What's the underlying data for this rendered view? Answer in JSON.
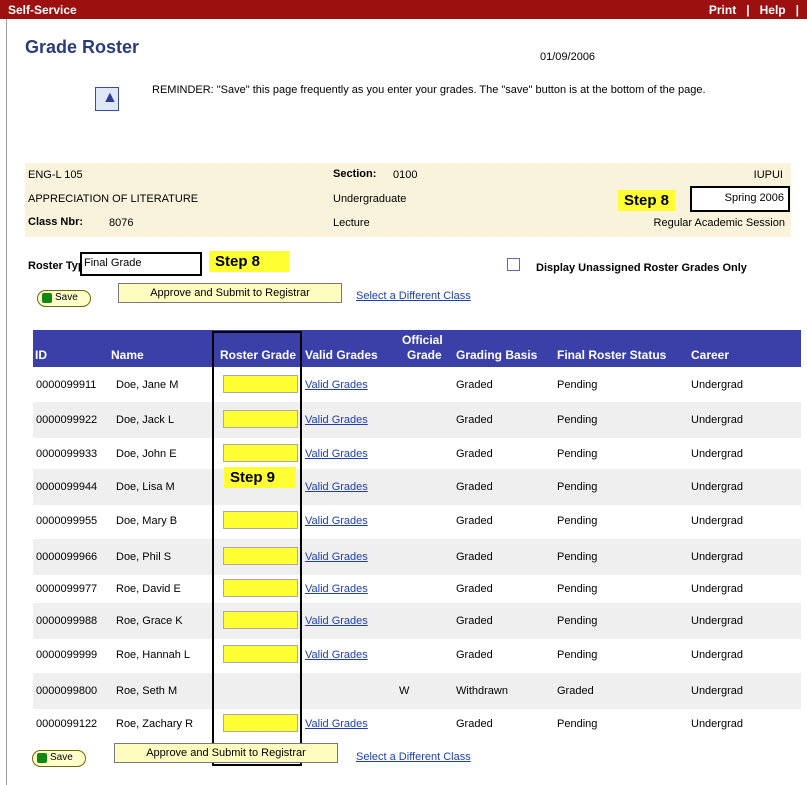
{
  "top_bar": {
    "left": "Self-Service",
    "print": "Print",
    "sep": "|",
    "help": "Help",
    "sep2": "|"
  },
  "title": "Grade Roster",
  "date": "01/09/2006",
  "reminder": "REMINDER:  \"Save\" this page frequently as you enter your grades.  The \"save\" button is at the bottom of the page.",
  "class_info": {
    "course": "ENG-L 105",
    "section_label": "Section:",
    "section": "0100",
    "institution": "IUPUI",
    "course_title": "APPRECIATION OF LITERATURE",
    "career": "Undergraduate",
    "term": "Spring 2006",
    "class_nbr_label": "Class Nbr:",
    "class_nbr": "8076",
    "component": "Lecture",
    "session": "Regular Academic Session"
  },
  "steps": {
    "step8a": "Step 8",
    "step8b": "Step 8",
    "step9": "Step 9"
  },
  "roster_type_label": "Roster Type:",
  "roster_type": "Final Grade",
  "display_unassigned": "Display Unassigned Roster Grades Only",
  "buttons": {
    "save": "Save",
    "approve": "Approve and Submit to Registrar",
    "select_class": "Select a Different Class"
  },
  "columns": {
    "id": "ID",
    "name": "Name",
    "roster_grade": "Roster Grade",
    "valid_grades": "Valid Grades",
    "official_grade_1": "Official",
    "official_grade_2": "Grade",
    "grading_basis": "Grading Basis",
    "final_status": "Final Roster Status",
    "career": "Career"
  },
  "rows": [
    {
      "id": "0000099911",
      "name": "Doe, Jane M",
      "grade_input": true,
      "valid": "Valid Grades",
      "official": "",
      "basis": "Graded",
      "status": "Pending",
      "career": "Undergrad"
    },
    {
      "id": "0000099922",
      "name": "Doe, Jack L",
      "grade_input": true,
      "valid": "Valid Grades",
      "official": "",
      "basis": "Graded",
      "status": "Pending",
      "career": "Undergrad"
    },
    {
      "id": "0000099933",
      "name": "Doe, John E",
      "grade_input": true,
      "valid": "Valid Grades",
      "official": "",
      "basis": "Graded",
      "status": "Pending",
      "career": "Undergrad"
    },
    {
      "id": "0000099944",
      "name": "Doe, Lisa M",
      "grade_input": false,
      "valid": "Valid Grades",
      "official": "",
      "basis": "Graded",
      "status": "Pending",
      "career": "Undergrad"
    },
    {
      "id": "0000099955",
      "name": "Doe, Mary B",
      "grade_input": true,
      "valid": "Valid Grades",
      "official": "",
      "basis": "Graded",
      "status": "Pending",
      "career": "Undergrad"
    },
    {
      "id": "0000099966",
      "name": "Doe, Phil S",
      "grade_input": true,
      "valid": "Valid Grades",
      "official": "",
      "basis": "Graded",
      "status": "Pending",
      "career": "Undergrad"
    },
    {
      "id": "0000099977",
      "name": "Roe, David E",
      "grade_input": true,
      "valid": "Valid Grades",
      "official": "",
      "basis": "Graded",
      "status": "Pending",
      "career": "Undergrad"
    },
    {
      "id": "0000099988",
      "name": "Roe, Grace K",
      "grade_input": true,
      "valid": "Valid Grades",
      "official": "",
      "basis": "Graded",
      "status": "Pending",
      "career": "Undergrad"
    },
    {
      "id": "0000099999",
      "name": "Roe, Hannah L",
      "grade_input": true,
      "valid": "Valid Grades",
      "official": "",
      "basis": "Graded",
      "status": "Pending",
      "career": "Undergrad"
    },
    {
      "id": "0000099800",
      "name": "Roe, Seth M",
      "grade_input": false,
      "valid": "",
      "official": "W",
      "basis": "Withdrawn",
      "status": "Graded",
      "career": "Undergrad"
    },
    {
      "id": "0000099122",
      "name": "Roe, Zachary R",
      "grade_input": true,
      "valid": "Valid Grades",
      "official": "",
      "basis": "Graded",
      "status": "Pending",
      "career": "Undergrad"
    }
  ]
}
